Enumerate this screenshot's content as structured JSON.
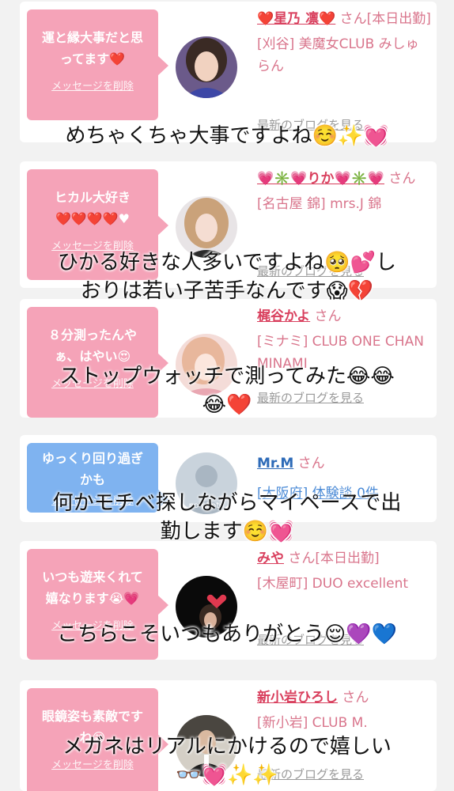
{
  "cards": [
    {
      "bubble": "運と縁大事だと思\nってます❤️",
      "delete_label": "メッセージを削除",
      "name": "❤️星乃 凛❤️",
      "suffix": " さん[本日出勤]",
      "shop": "[刈谷] 美魔女CLUB みしゅらん",
      "blog": "最新のブログを見る",
      "caption": "めちゃくちゃ大事ですよね☺️✨💓"
    },
    {
      "bubble": "ヒカル大好き\n❤️❤️❤️❤️♥",
      "delete_label": "メッセージを削除",
      "name": "💗✳️💗りか💗✳️💗",
      "suffix": " さん",
      "shop": "[名古屋 錦] mrs.J 錦",
      "blog": "最新のブログを見る",
      "caption": "ひかる好きな人多いですよね🥺💕し\nおりは若い子苦手なんです😱💔"
    },
    {
      "bubble": "８分測ったんや\nぁ、はやい😍",
      "delete_label": "メッセージを削除",
      "name": "梶谷かよ",
      "suffix": " さん",
      "shop": "[ミナミ] CLUB ONE CHAN MINAMI",
      "blog": "最新のブログを見る",
      "caption": "ストップウォッチで測ってみた😂😂\n😂❤️"
    },
    {
      "bubble": "ゆっくり回り過ぎ\nかも",
      "delete_label": "メッセージを削除",
      "name": "Mr.M",
      "suffix": " さん",
      "shop": "[大阪府] 体験談 0件",
      "blog": "",
      "caption": "何かモチベ探しながらマイペースで出\n勤します☺️💓"
    },
    {
      "bubble": "いつも遊来くれて\n嬉なります😭💗",
      "delete_label": "メッセージを削除",
      "name": "みや",
      "suffix": " さん[本日出勤]",
      "shop": "[木屋町] DUO excellent",
      "blog": "最新のブログを見る",
      "caption": "こちらこそいつもありがとう😌💜💙"
    },
    {
      "bubble": "眼鏡姿も素敵です\nね😁",
      "delete_label": "メッセージを削除",
      "name": "新小岩ひろし",
      "suffix": " さん",
      "shop": "[新小岩] CLUB M.",
      "blog": "最新のブログを見る",
      "caption": "メガネはリアルにかけるので嬉しい\n👓💓✨✨"
    }
  ],
  "avatar_placeholder": "no photo",
  "colors": {
    "pink_bubble": "#f5a3b8",
    "blue_bubble": "#7fb3f0",
    "name_pink": "#d9405e",
    "name_blue": "#2e6bb8"
  }
}
